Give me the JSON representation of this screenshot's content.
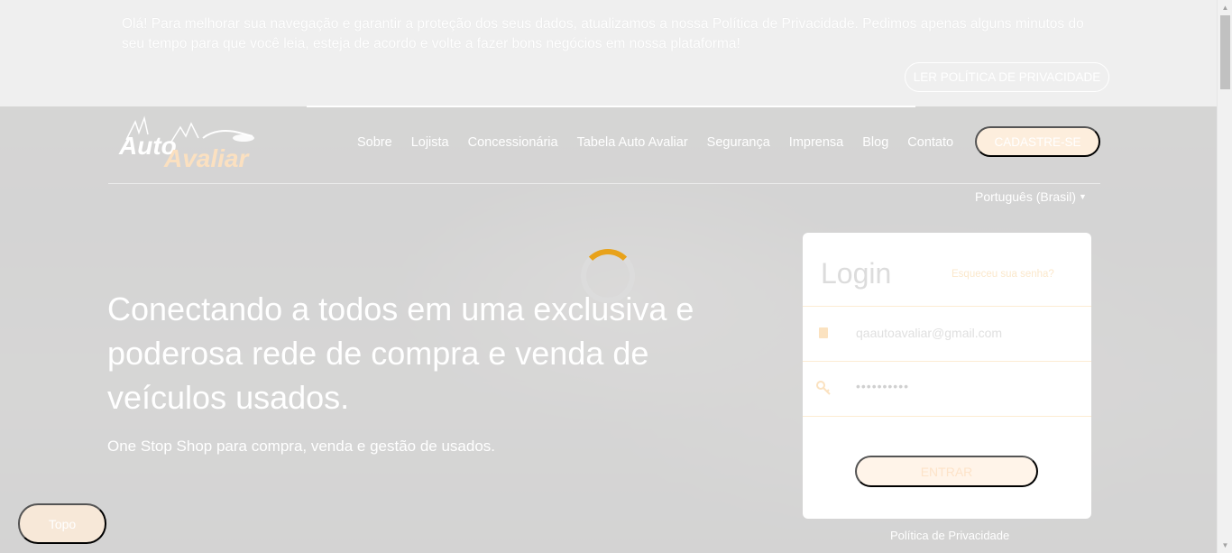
{
  "privacy_banner": {
    "text": "Olá! Para melhorar sua navegação e garantir a proteção dos seus dados, atualizamos a nossa Política de Privacidade. Pedimos apenas alguns minutos do seu tempo para que você leia, esteja de acordo e volte a fazer bons negócios em nossa plataforma!",
    "button_label": "LER POLÍTICA DE PRIVACIDADE"
  },
  "header": {
    "logo": "Auto Avaliar",
    "nav": [
      "Sobre",
      "Lojista",
      "Concessionária",
      "Tabela Auto Avaliar",
      "Segurança",
      "Imprensa",
      "Blog",
      "Contato"
    ],
    "signup_label": "CADASTRE-SE",
    "language": "Português (Brasil)"
  },
  "hero": {
    "title": "Conectando a todos em uma exclusiva e poderosa rede de compra e venda de veículos usados.",
    "subtitle": "One Stop Shop para compra, venda e gestão de usados."
  },
  "login": {
    "title": "Login",
    "forgot_label": "Esqueceu sua senha?",
    "email_value": "qaautoavaliar@gmail.com",
    "password_value": "••••••••••",
    "enter_label": "ENTRAR",
    "user_icon": "user-icon",
    "key_icon": "key-icon"
  },
  "footer": {
    "policy_link": "Política de Privacidade",
    "topo_label": "Topo"
  },
  "colors": {
    "accent": "#e8a21a",
    "banner_bg": "#efefef"
  }
}
